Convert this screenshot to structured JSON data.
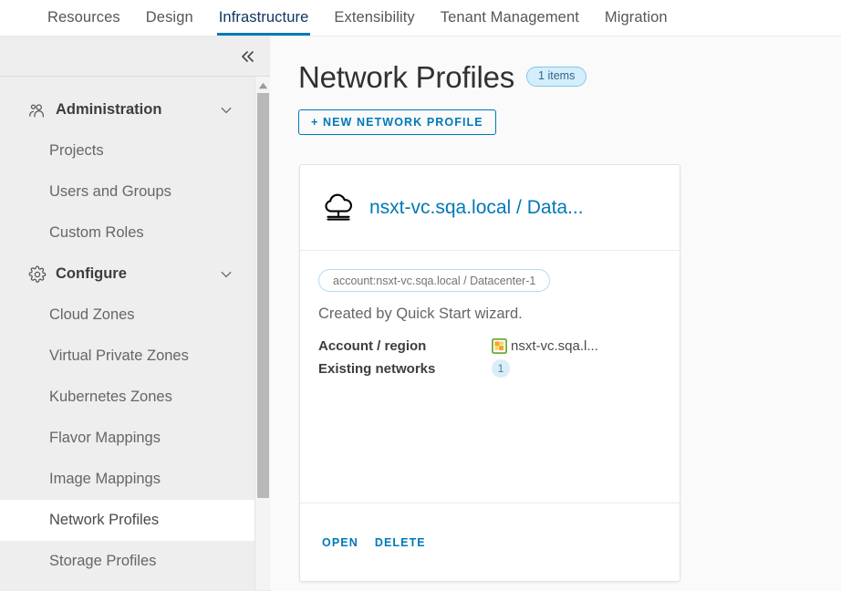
{
  "top_nav": {
    "tabs": [
      {
        "label": "Resources",
        "active": false
      },
      {
        "label": "Design",
        "active": false
      },
      {
        "label": "Infrastructure",
        "active": true
      },
      {
        "label": "Extensibility",
        "active": false
      },
      {
        "label": "Tenant Management",
        "active": false
      },
      {
        "label": "Migration",
        "active": false
      }
    ],
    "active_underline_color": "#0079b8"
  },
  "sidebar": {
    "collapse_tooltip": "Collapse",
    "groups": [
      {
        "label": "Administration",
        "icon": "users-group-icon",
        "expanded": true,
        "items": [
          {
            "label": "Projects",
            "selected": false
          },
          {
            "label": "Users and Groups",
            "selected": false
          },
          {
            "label": "Custom Roles",
            "selected": false
          }
        ]
      },
      {
        "label": "Configure",
        "icon": "gear-icon",
        "expanded": true,
        "items": [
          {
            "label": "Cloud Zones",
            "selected": false
          },
          {
            "label": "Virtual Private Zones",
            "selected": false
          },
          {
            "label": "Kubernetes Zones",
            "selected": false
          },
          {
            "label": "Flavor Mappings",
            "selected": false
          },
          {
            "label": "Image Mappings",
            "selected": false
          },
          {
            "label": "Network Profiles",
            "selected": true
          },
          {
            "label": "Storage Profiles",
            "selected": false
          }
        ]
      }
    ]
  },
  "main": {
    "title": "Network Profiles",
    "items_badge": "1 items",
    "new_button": "+ NEW NETWORK PROFILE",
    "card": {
      "icon": "cloud-network-icon",
      "title": "nsxt-vc.sqa.local / Data...",
      "tag": "account:nsxt-vc.sqa.local / Datacenter-1",
      "description": "Created by Quick Start wizard.",
      "details": [
        {
          "label": "Account / region",
          "value": "nsxt-vc.sqa.l...",
          "icon": "vsphere-icon",
          "badge": null
        },
        {
          "label": "Existing networks",
          "value": null,
          "icon": null,
          "badge": "1"
        }
      ],
      "actions": [
        {
          "label": "OPEN"
        },
        {
          "label": "DELETE"
        }
      ]
    }
  },
  "colors": {
    "accent_blue": "#0079b8",
    "badge_bg": "#d5eefb",
    "badge_border": "#85c6e5",
    "sidebar_bg": "#eeeeee",
    "page_bg": "#fafafa"
  }
}
